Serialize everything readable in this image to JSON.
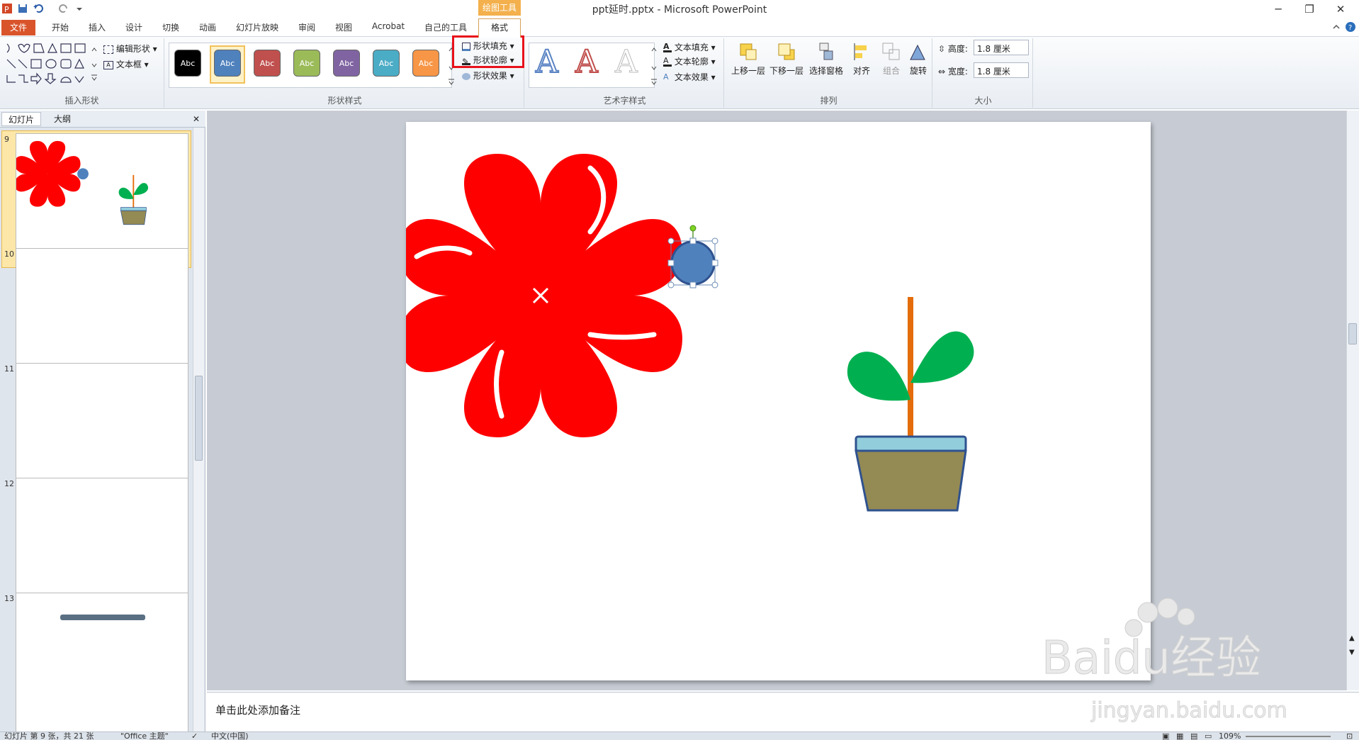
{
  "window": {
    "title": "ppt延时.pptx - Microsoft PowerPoint",
    "min": "─",
    "restore": "❐",
    "close": "✕"
  },
  "context_group": "绘图工具",
  "tabs": {
    "file": "文件",
    "items": [
      "开始",
      "插入",
      "设计",
      "切换",
      "动画",
      "幻灯片放映",
      "审阅",
      "视图",
      "Acrobat",
      "自己的工具"
    ],
    "format": "格式"
  },
  "ribbon": {
    "insert_shapes": {
      "edit_shape": "编辑形状",
      "text_box": "文本框",
      "label": "插入形状"
    },
    "shape_styles": {
      "swatch_text": "Abc",
      "fill": "形状填充",
      "outline": "形状轮廓",
      "effects": "形状效果",
      "label": "形状样式",
      "swatch_colors": [
        "#000000",
        "#4f81bd",
        "#c0504d",
        "#9bbb59",
        "#8064a2",
        "#4bacc6",
        "#f79646"
      ]
    },
    "wordart": {
      "text_fill": "文本填充",
      "text_outline": "文本轮廓",
      "text_effects": "文本效果",
      "label": "艺术字样式",
      "glyph": "A"
    },
    "arrange": {
      "bring_forward": "上移一层",
      "send_backward": "下移一层",
      "selection_pane": "选择窗格",
      "align": "对齐",
      "group": "组合",
      "rotate": "旋转",
      "label": "排列"
    },
    "size": {
      "height_label": "高度:",
      "height_value": "1.8 厘米",
      "width_label": "宽度:",
      "width_value": "1.8 厘米",
      "label": "大小"
    }
  },
  "left_pane": {
    "tab_slides": "幻灯片",
    "tab_outline": "大纲",
    "close": "✕",
    "thumbs": [
      "9",
      "10",
      "11",
      "12",
      "13"
    ]
  },
  "notes": {
    "placeholder": "单击此处添加备注"
  },
  "status": {
    "slide_info": "幻灯片 第 9 张，共 21 张",
    "theme": "\"Office 主题\"",
    "language": "中文(中国)",
    "zoom": "109%"
  },
  "watermark": {
    "brand": "Baidu经验",
    "url": "jingyan.baidu.com"
  },
  "colors": {
    "accent": "#d9542b",
    "highlight_box": "#e8111b",
    "flower": "#ff0000",
    "circle": "#4f81bd",
    "leaf": "#00b050",
    "stem": "#e46c0a",
    "pot_rim": "#92cddc",
    "pot": "#948a54"
  }
}
